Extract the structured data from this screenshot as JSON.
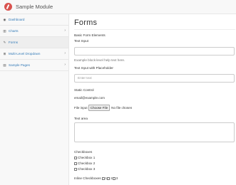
{
  "app": {
    "brand": "Sample Module"
  },
  "sidebar": {
    "items": [
      {
        "label": "Dashboard",
        "icon": "dashboard-icon",
        "glyph": "◉",
        "has_children": false
      },
      {
        "label": "Charts",
        "icon": "bar-chart-icon",
        "glyph": "▥",
        "has_children": true
      },
      {
        "label": "Forms",
        "icon": "edit-icon",
        "glyph": "✎",
        "has_children": false
      },
      {
        "label": "Multi-Level Dropdown",
        "icon": "sitemap-icon",
        "glyph": "⊞",
        "has_children": true
      },
      {
        "label": "Sample Pages",
        "icon": "files-icon",
        "glyph": "▤",
        "has_children": true
      }
    ],
    "active_index": 2,
    "chevron_glyph": "›"
  },
  "main": {
    "title": "Forms",
    "section_title": "Basic Form Elements",
    "text_input": {
      "label": "Text Input",
      "value": "",
      "help": "Example block-level help text here."
    },
    "placeholder_input": {
      "label": "Text Input with Placeholder",
      "placeholder": "Enter text"
    },
    "static_control": {
      "label": "Static Control",
      "value": "email@example.com"
    },
    "file_input": {
      "label": "File input",
      "button": "Choose File",
      "status": "No file chosen"
    },
    "text_area": {
      "label": "Text area"
    },
    "checkboxes": {
      "label": "Checkboxes",
      "items": [
        "Checkbox 1",
        "Checkbox 2",
        "Checkbox 3"
      ]
    },
    "inline_checkboxes": {
      "label": "Inline Checkboxes",
      "items": [
        "1",
        "2",
        "3"
      ]
    }
  },
  "colors": {
    "accent": "#337ab7",
    "logo": "#d9534f",
    "sidebar_bg": "#f8f8f8"
  }
}
